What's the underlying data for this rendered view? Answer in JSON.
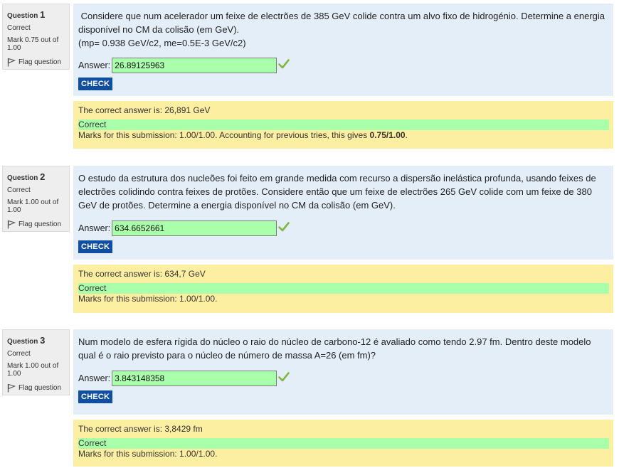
{
  "questions": [
    {
      "label": "Question",
      "number": "1",
      "state": "Correct",
      "grade": "Mark 0.75 out of 1.00",
      "flag_label": "Flag question",
      "text_lines": [
        " Considere que num acelerador um feixe de electrões de 385 GeV colide contra um alvo fixo de hidrogénio. Determine a energia disponível no CM da colisão (em GeV).",
        "(mp= 0.938 GeV/c2, me=0.5E-3 GeV/c2)"
      ],
      "answer_label": "Answer:",
      "answer_value": "26.89125963",
      "check_label": "CHECK",
      "right_answer": "The correct answer is: 26,891 GeV",
      "feedback_state": "Correct",
      "marks_text": "Marks for this submission: 1.00/1.00. Accounting for previous tries, this gives ",
      "marks_bold": "0.75/1.00",
      "marks_tail": "."
    },
    {
      "label": "Question",
      "number": "2",
      "state": "Correct",
      "grade": "Mark 1.00 out of 1.00",
      "flag_label": "Flag question",
      "text_lines": [
        "O estudo da estrutura dos nucleões foi feito em grande medida com recurso a dispersão inelástica profunda, usando feixes de electrões colidindo contra feixes de protões. Considere então que um feixe de electrões 265 GeV colide com um feixe de 380 GeV de protões. Determine a energia disponível no CM da colisão (em GeV)."
      ],
      "answer_label": "Answer:",
      "answer_value": "634.6652661",
      "check_label": "CHECK",
      "right_answer": "The correct answer is: 634,7 GeV",
      "feedback_state": "Correct",
      "marks_text": "Marks for this submission: 1.00/1.00.",
      "marks_bold": "",
      "marks_tail": ""
    },
    {
      "label": "Question",
      "number": "3",
      "state": "Correct",
      "grade": "Mark 1.00 out of 1.00",
      "flag_label": "Flag question",
      "text_lines": [
        "Num modelo de esfera rígida do núcleo o raio do núcleo de carbono-12 é avaliado como tendo 2.97 fm. Dentro deste modelo qual é o raio previsto para o núcleo de número de massa A=26 (em fm)?"
      ],
      "answer_label": "Answer:",
      "answer_value": "3.843148358",
      "check_label": "CHECK",
      "right_answer": "The correct answer is: 3,8429 fm",
      "feedback_state": "Correct",
      "marks_text": "Marks for this submission: 1.00/1.00.",
      "marks_bold": "",
      "marks_tail": ""
    }
  ],
  "colors": {
    "info_bg": "#eeeeee",
    "formulation_bg": "#e4eef8",
    "outcome_bg": "#fcefa1",
    "correct_green": "#aaffaa",
    "check_button": "#0f4ea2",
    "tick": "#7fb93a"
  },
  "icons": {
    "flag": "flag-icon",
    "tick": "check-mark-icon"
  }
}
